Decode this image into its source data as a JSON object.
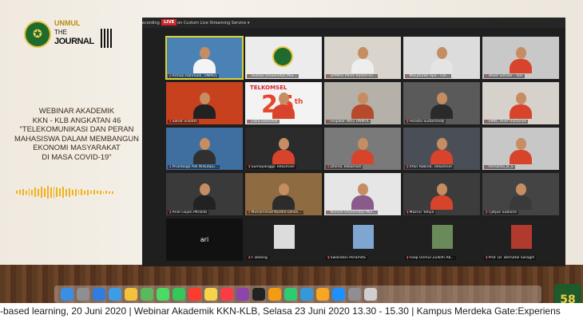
{
  "logo": {
    "brand": "UNMUL",
    "line1": "THE",
    "line2": "JOURNAL"
  },
  "title_lines": [
    "WEBINAR AKADEMIK",
    "KKN - KLB ANGKATAN 46",
    "\"TELEKOMUNIKASI DAN PERAN",
    "MAHASISWA DALAM MEMBANGUN",
    "EKONOMI MASYARAKAT",
    "DI MASA COVID-19\""
  ],
  "zoom": {
    "recording_label": "ecording",
    "live_label": "LIVE",
    "stream_label": "on Custom Live Streaming Service ▾",
    "participants": [
      {
        "name": "Arman Rahmadi, UNMUL"
      },
      {
        "name": "Humas Universitas Mul..."
      },
      {
        "name": "DPMPD PROV Kaltim-Di..."
      },
      {
        "name": "Masyfufah Apo - Cle..."
      },
      {
        "name": "Wiwit Setiadi - Tsel"
      },
      {
        "name": "Sahat Silalahi"
      },
      {
        "name": "Citra Dahrielle"
      },
      {
        "name": "Fisipwar WR2 UNMUL"
      },
      {
        "name": "Hirosta Sudarmadji"
      },
      {
        "name": "SMKC Arief Hartanan"
      },
      {
        "name": "Prianbogo Adi W.Kutipu..."
      },
      {
        "name": "Sumayanggo Telkomsel"
      },
      {
        "name": "Dhimo Telkomsel"
      },
      {
        "name": "Irfan Robind, Telkomsel"
      },
      {
        "name": "Asmanto_B_S"
      },
      {
        "name": "Andi Gajan PKTbnb"
      },
      {
        "name": "Muhammad Nurdin-Dinas..."
      },
      {
        "name": "Nurlish Universitas Mul..."
      },
      {
        "name": "Mazrur Yahya"
      },
      {
        "name": "Tjatjuk Subiono"
      },
      {
        "name": "ari"
      },
      {
        "name": "F Delong"
      },
      {
        "name": "Swandani Peramita"
      },
      {
        "name": "Foap Unmul Zulkifli Ab..."
      },
      {
        "name": "Prof. Dr. Bernatal Saragih"
      }
    ],
    "tile_text": {
      "telkomsel": "TELKOMSEL",
      "big_number": "25",
      "suffix": "th"
    }
  },
  "ticker": "-based learning, 20 Juni 2020 | Webinar Akademik KKN-KLB, Selasa 23 Juni 2020 13.30 - 15.30 | Kampus Merdeka Gate:Experiens",
  "dock_icons": [
    "finder-icon",
    "launchpad-icon",
    "safari-icon",
    "mail-icon",
    "photos-icon",
    "maps-icon",
    "messages-icon",
    "facetime-icon",
    "calendar-icon",
    "notes-icon",
    "music-icon",
    "podcasts-icon",
    "tv-icon",
    "books-icon",
    "numbers-icon",
    "keynote-icon",
    "pages-icon",
    "appstore-icon",
    "settings-icon",
    "trash-icon"
  ],
  "colors": {
    "live": "#d3242b",
    "accent": "#f2b21c",
    "active_border": "#d9d233"
  }
}
